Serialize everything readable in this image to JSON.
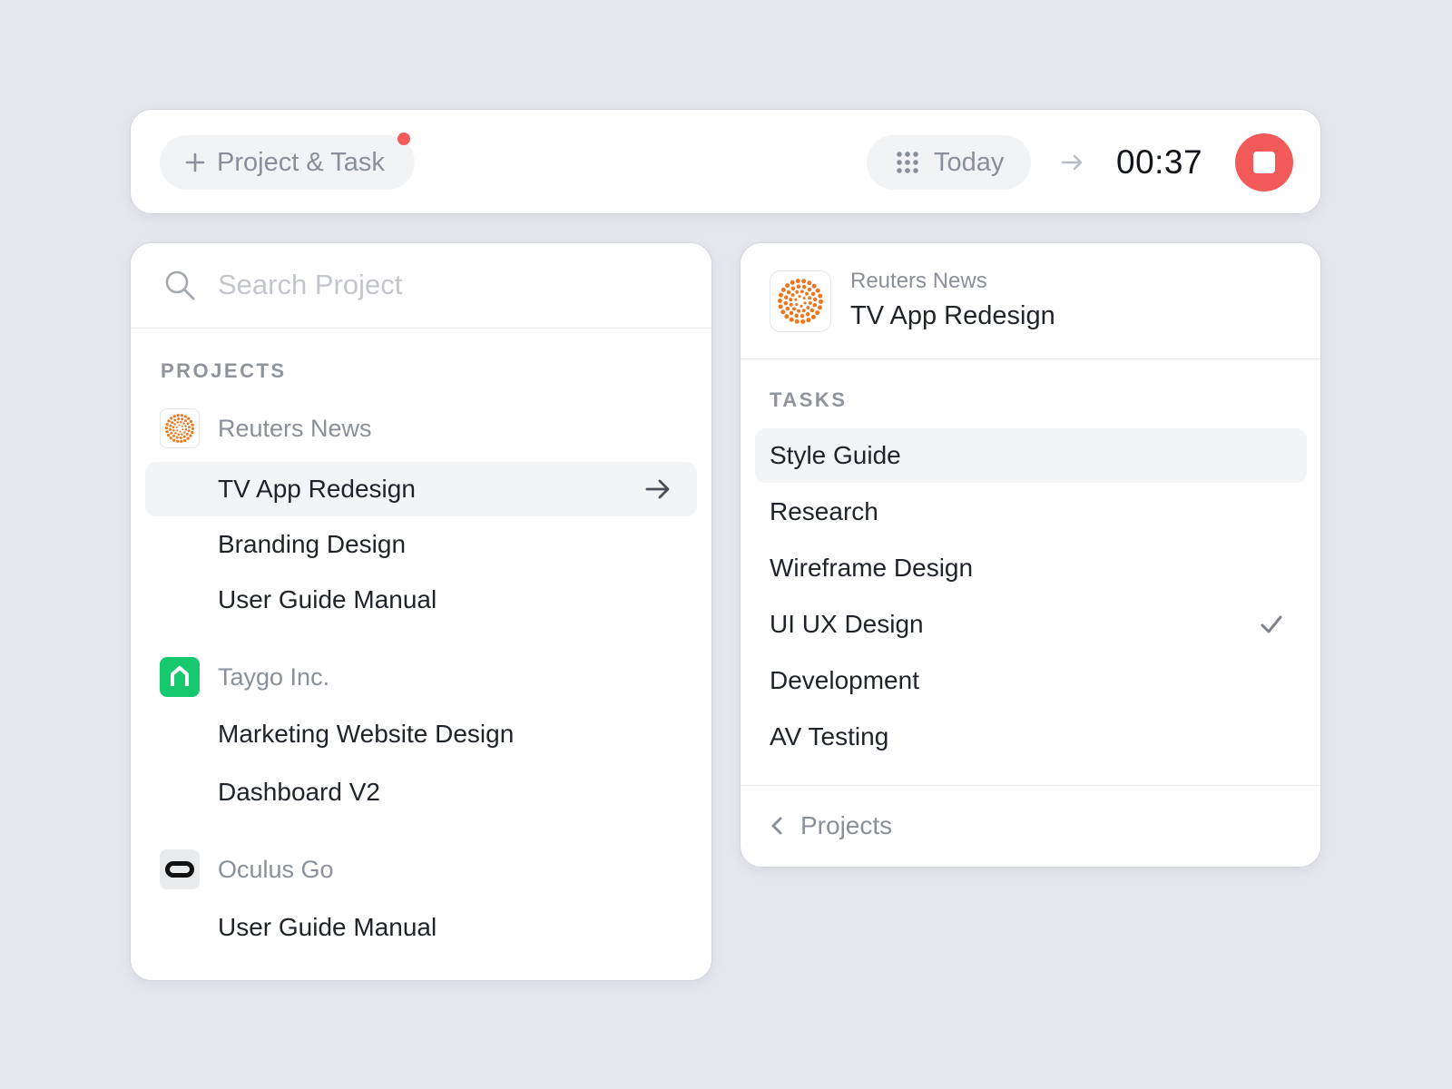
{
  "topbar": {
    "add_label": "Project & Task",
    "has_notification": true,
    "range_label": "Today",
    "timer": "00:37"
  },
  "search": {
    "placeholder": "Search Project",
    "value": ""
  },
  "projects": {
    "section_label": "PROJECTS",
    "clients": [
      {
        "name": "Reuters News",
        "logo": "reuters-logo",
        "projects": [
          "TV App Redesign",
          "Branding Design",
          "User Guide Manual"
        ]
      },
      {
        "name": "Taygo Inc.",
        "logo": "taygo-logo",
        "projects": [
          "Marketing Website Design",
          "Dashboard V2"
        ]
      },
      {
        "name": "Oculus Go",
        "logo": "oculus-logo",
        "projects": [
          "User Guide Manual"
        ]
      }
    ],
    "selected": "TV App Redesign"
  },
  "detail": {
    "client": "Reuters News",
    "project": "TV App Redesign",
    "tasks_label": "TASKS",
    "tasks": [
      "Style Guide",
      "Research",
      "Wireframe Design",
      "UI UX Design",
      "Development",
      "AV Testing"
    ],
    "highlighted_task": "Style Guide",
    "checked_task": "UI UX Design",
    "back_label": "Projects"
  },
  "colors": {
    "background": "#E5E7EC",
    "stop_button": "#F25A5A",
    "notification_dot": "#F25C5C",
    "reuters_orange": "#F0761E",
    "taygo_green": "#16C96F",
    "muted_text": "#8A9099"
  }
}
